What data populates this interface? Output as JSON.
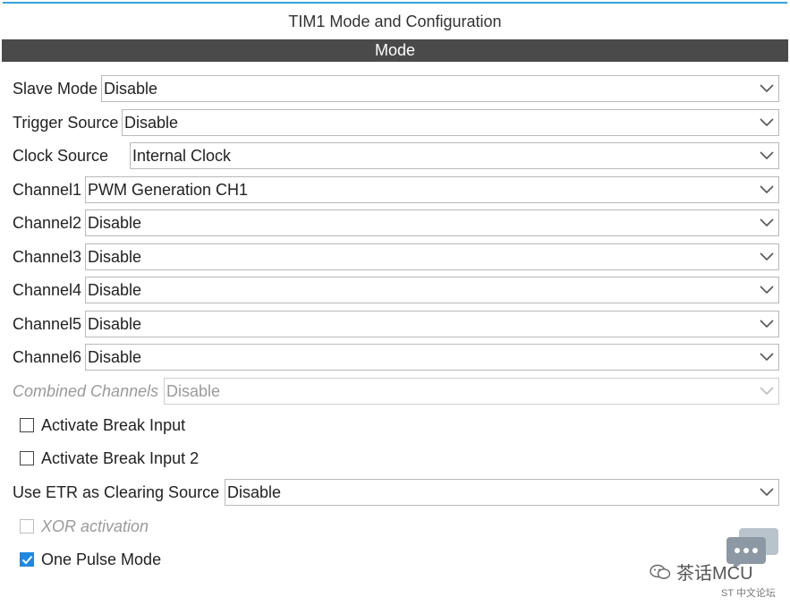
{
  "title": "TIM1 Mode and Configuration",
  "section": "Mode",
  "fields": {
    "slave_mode": {
      "label": "Slave Mode",
      "value": "Disable"
    },
    "trigger_source": {
      "label": "Trigger Source",
      "value": "Disable"
    },
    "clock_source": {
      "label": "Clock Source",
      "value": "Internal Clock"
    },
    "channel1": {
      "label": "Channel1",
      "value": "PWM Generation CH1"
    },
    "channel2": {
      "label": "Channel2",
      "value": "Disable"
    },
    "channel3": {
      "label": "Channel3",
      "value": "Disable"
    },
    "channel4": {
      "label": "Channel4",
      "value": "Disable"
    },
    "channel5": {
      "label": "Channel5",
      "value": "Disable"
    },
    "channel6": {
      "label": "Channel6",
      "value": "Disable"
    },
    "combined_channels": {
      "label": "Combined Channels",
      "value": "Disable",
      "enabled": false
    },
    "use_etr": {
      "label": "Use ETR as Clearing Source",
      "value": "Disable"
    }
  },
  "checkboxes": {
    "break_input": {
      "label": "Activate Break Input",
      "checked": false
    },
    "break_input_2": {
      "label": "Activate Break Input 2",
      "checked": false
    },
    "xor_activation": {
      "label": "XOR activation",
      "checked": false,
      "enabled": false
    },
    "one_pulse_mode": {
      "label": "One Pulse Mode",
      "checked": true
    }
  },
  "watermark": {
    "text": "茶话MCU",
    "sub": "ST 中文论坛"
  },
  "colors": {
    "accent": "#1e88e5",
    "section_bar": "#4a4a4a",
    "top_line": "#3aa0d8"
  },
  "icons": {
    "dropdown": "chevron-down-icon",
    "check": "checkmark-icon"
  }
}
